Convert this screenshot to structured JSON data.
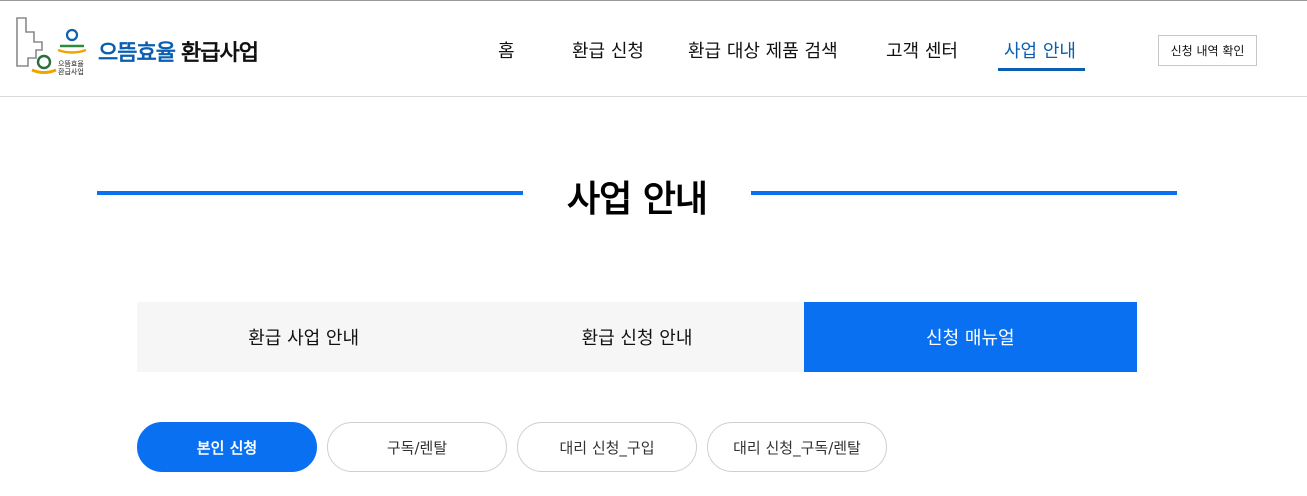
{
  "header": {
    "logo_text": "으뜸효율 환급사업",
    "brand_part1": "으뜸효율",
    "brand_part2": "환급사업",
    "status_button": "신청 내역 확인"
  },
  "nav": {
    "items": [
      {
        "label": "홈"
      },
      {
        "label": "환급 신청"
      },
      {
        "label": "환급 대상 제품 검색"
      },
      {
        "label": "고객 센터"
      },
      {
        "label": "사업 안내",
        "active": true
      }
    ]
  },
  "main": {
    "title": "사업 안내",
    "tabs": [
      {
        "label": "환급 사업 안내"
      },
      {
        "label": "환급 신청 안내"
      },
      {
        "label": "신청 매뉴얼",
        "active": true
      }
    ],
    "pills": [
      {
        "label": "본인 신청",
        "active": true
      },
      {
        "label": "구독/렌탈"
      },
      {
        "label": "대리 신청_구입"
      },
      {
        "label": "대리 신청_구독/렌탈"
      }
    ]
  },
  "colors": {
    "brand_blue": "#0c5fb0",
    "accent_blue": "#0a70f2",
    "tab_bg": "#f6f6f6"
  }
}
